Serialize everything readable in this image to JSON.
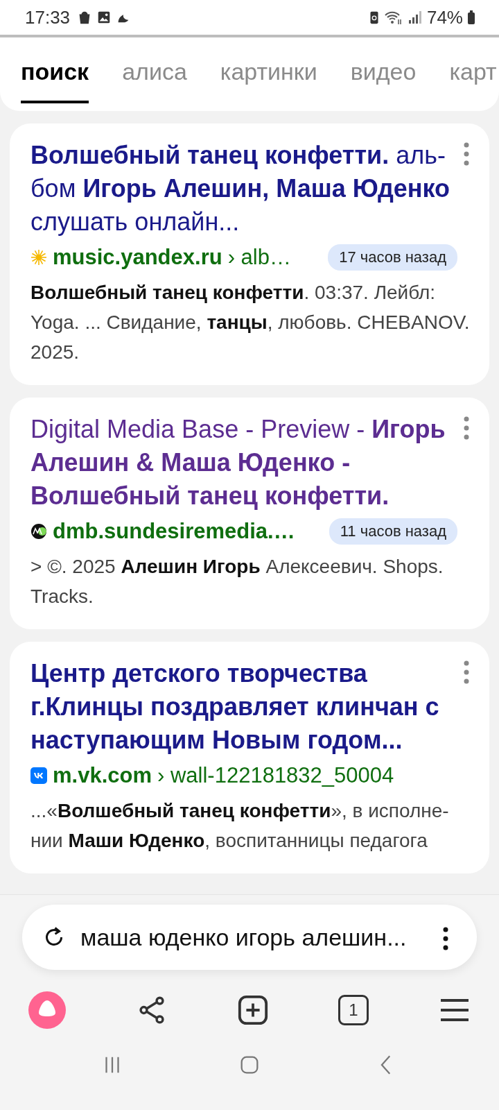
{
  "status_bar": {
    "time": "17:33",
    "battery": "74%"
  },
  "tabs": [
    {
      "label": "поиск",
      "selected": true
    },
    {
      "label": "алиса",
      "selected": false
    },
    {
      "label": "картинки",
      "selected": false
    },
    {
      "label": "видео",
      "selected": false
    },
    {
      "label": "карт",
      "selected": false
    }
  ],
  "results": [
    {
      "title": "**Волшебный танец конфетти.** аль-бом **Игорь Алешин, Маша Юденко** слушать онлайн...",
      "visited": false,
      "kind": "sun",
      "domain": "music.yandex.ru",
      "path": "› alb…",
      "badge": "17 часов назад",
      "snippet": "**Волшебный танец конфетти**. 03:37. Лейбл: Yoga. ... Свидание, **танцы**, любовь. CHEBANOV. 2025."
    },
    {
      "title": "Digital Media Base - Preview - **Игорь Алешин & Маша Юденко - Волшебный танец конфетти.**",
      "visited": true,
      "kind": "mix",
      "domain": "dmb.sundesiremedia.…",
      "badge": "11 часов назад",
      "snippet": "> ©. 2025 **Алешин Игорь** Алексеевич. Shops. Tracks."
    },
    {
      "title": "**Центр детского творчества г.Клинцы поздравляет клинчан с наступающим Новым годом...**",
      "visited": false,
      "kind": "vk",
      "domain": "m.vk.com",
      "path": "› wall-122181832_50004",
      "snippet": "...«**Волшебный танец конфетти**», в исполне-нии **Маши Юденко**, воспитанницы педагога"
    }
  ],
  "search_bar": {
    "query": "маша юденко игорь алешин..."
  },
  "toolbar": {
    "tab_count": "1"
  }
}
